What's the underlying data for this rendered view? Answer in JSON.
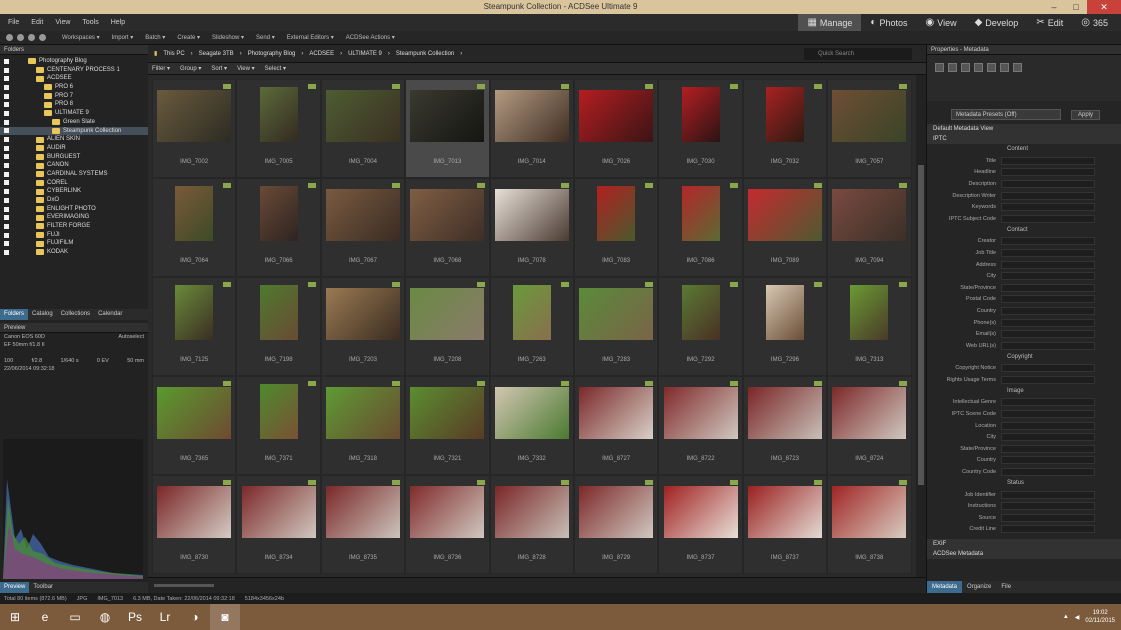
{
  "window": {
    "title": "Steampunk Collection - ACDSee Ultimate 9",
    "min": "–",
    "max": "□",
    "close": "✕"
  },
  "menu": [
    "File",
    "Edit",
    "View",
    "Tools",
    "Help"
  ],
  "modes": [
    {
      "icon": "grid-icon",
      "glyph": "▦",
      "label": "Manage",
      "active": true
    },
    {
      "icon": "photos-icon",
      "glyph": "◐",
      "label": "Photos",
      "active": false
    },
    {
      "icon": "view-icon",
      "glyph": "◉",
      "label": "View",
      "active": false
    },
    {
      "icon": "develop-icon",
      "glyph": "◆",
      "label": "Develop",
      "active": false
    },
    {
      "icon": "edit-icon",
      "glyph": "✂",
      "label": "Edit",
      "active": false
    },
    {
      "icon": "365-icon",
      "glyph": "◎",
      "label": "365",
      "active": false
    }
  ],
  "toolbar": [
    "Workspaces ▾",
    "Import ▾",
    "Batch ▾",
    "Create ▾",
    "Slideshow ▾",
    "Send ▾",
    "External Editors ▾",
    "ACDSee Actions ▾"
  ],
  "folders_panel": {
    "title": "Folders"
  },
  "folders": [
    {
      "name": "Photography Blog",
      "indent": 32,
      "sel": false
    },
    {
      "name": "CENTENARY PROCESS 1",
      "indent": 40,
      "sel": false
    },
    {
      "name": "ACDSEE",
      "indent": 40,
      "sel": false
    },
    {
      "name": "PRO 6",
      "indent": 48,
      "sel": false
    },
    {
      "name": "PRO 7",
      "indent": 48,
      "sel": false
    },
    {
      "name": "PRO 8",
      "indent": 48,
      "sel": false
    },
    {
      "name": "ULTIMATE 9",
      "indent": 48,
      "sel": false
    },
    {
      "name": "Green Slate",
      "indent": 56,
      "sel": false
    },
    {
      "name": "Steampunk Collection",
      "indent": 56,
      "sel": true
    },
    {
      "name": "ALIEN SKIN",
      "indent": 40,
      "sel": false
    },
    {
      "name": "AUDIR",
      "indent": 40,
      "sel": false
    },
    {
      "name": "BURGUEST",
      "indent": 40,
      "sel": false
    },
    {
      "name": "CANON",
      "indent": 40,
      "sel": false
    },
    {
      "name": "CARDINAL SYSTEMS",
      "indent": 40,
      "sel": false
    },
    {
      "name": "COREL",
      "indent": 40,
      "sel": false
    },
    {
      "name": "CYBERLINK",
      "indent": 40,
      "sel": false
    },
    {
      "name": "DxO",
      "indent": 40,
      "sel": false
    },
    {
      "name": "ENLIGHT PHOTO",
      "indent": 40,
      "sel": false
    },
    {
      "name": "EVERIMAGING",
      "indent": 40,
      "sel": false
    },
    {
      "name": "FILTER FORGE",
      "indent": 40,
      "sel": false
    },
    {
      "name": "FUJI",
      "indent": 40,
      "sel": false
    },
    {
      "name": "FUJIFILM",
      "indent": 40,
      "sel": false
    },
    {
      "name": "KODAK",
      "indent": 40,
      "sel": false
    }
  ],
  "lefttabs": [
    "Folders",
    "Catalog",
    "Collections",
    "Calendar"
  ],
  "preview": {
    "title": "Preview",
    "camera": "Canon EOS 60D",
    "lens": "EF 50mm f/1.8 II",
    "mode": "Autoselect",
    "iso": "100",
    "ap": "f/2.8",
    "speed": "1/640 s",
    "ev": "0 EV",
    "focal": "50 mm",
    "date": "22/06/2014 09:32:18"
  },
  "lefttabs2": [
    "Preview",
    "Toolbar"
  ],
  "path": [
    "This PC",
    "Seagate 3TB",
    "Photography Blog",
    "ACDSEE",
    "ULTIMATE 9",
    "Steampunk Collection"
  ],
  "search_placeholder": "Quick Search",
  "filters": [
    "Filter ▾",
    "Group ▾",
    "Sort ▾",
    "View ▾",
    "Select ▾"
  ],
  "thumbs": [
    {
      "name": "IMG_7002",
      "c1": "#6a5a3e",
      "c2": "#2c2c22",
      "p": false
    },
    {
      "name": "IMG_7005",
      "c1": "#5c6a3a",
      "c2": "#332a22",
      "p": true
    },
    {
      "name": "IMG_7004",
      "c1": "#4e5c32",
      "c2": "#3a3022",
      "p": false
    },
    {
      "name": "IMG_7013",
      "c1": "#3a3a30",
      "c2": "#151512",
      "p": false
    },
    {
      "name": "IMG_7014",
      "c1": "#b49a82",
      "c2": "#3e2e22",
      "p": false
    },
    {
      "name": "IMG_7026",
      "c1": "#b41e22",
      "c2": "#3a1414",
      "p": false
    },
    {
      "name": "IMG_7030",
      "c1": "#b41e22",
      "c2": "#2a1414",
      "p": true
    },
    {
      "name": "IMG_7032",
      "c1": "#a82222",
      "c2": "#2e1a12",
      "p": true
    },
    {
      "name": "IMG_7057",
      "c1": "#6e4e34",
      "c2": "#3a4428",
      "p": false
    },
    {
      "name": "IMG_7064",
      "c1": "#7a5a3a",
      "c2": "#3e4a26",
      "p": true
    },
    {
      "name": "IMG_7066",
      "c1": "#6a4a36",
      "c2": "#2e2422",
      "p": true
    },
    {
      "name": "IMG_7067",
      "c1": "#7a5a40",
      "c2": "#3a2c24",
      "p": false
    },
    {
      "name": "IMG_7068",
      "c1": "#805e44",
      "c2": "#3e2e26",
      "p": false
    },
    {
      "name": "IMG_7078",
      "c1": "#e8e0d8",
      "c2": "#4a3a32",
      "p": false
    },
    {
      "name": "IMG_7083",
      "c1": "#b02020",
      "c2": "#4a5a2e",
      "p": true
    },
    {
      "name": "IMG_7086",
      "c1": "#b4262a",
      "c2": "#5a6a34",
      "p": true
    },
    {
      "name": "IMG_7089",
      "c1": "#c42a30",
      "c2": "#4e5a30",
      "p": false
    },
    {
      "name": "IMG_7094",
      "c1": "#7a4a40",
      "c2": "#3a3028",
      "p": false
    },
    {
      "name": "IMG_7125",
      "c1": "#6a8a3a",
      "c2": "#3a2e22",
      "p": true
    },
    {
      "name": "IMG_7198",
      "c1": "#4e7a2e",
      "c2": "#6a4a34",
      "p": true
    },
    {
      "name": "IMG_7203",
      "c1": "#9a7a54",
      "c2": "#3a2c20",
      "p": false
    },
    {
      "name": "IMG_7208",
      "c1": "#6a8a44",
      "c2": "#8a7a6a",
      "p": false
    },
    {
      "name": "IMG_7263",
      "c1": "#6a9a3a",
      "c2": "#8a6e4e",
      "p": true
    },
    {
      "name": "IMG_7283",
      "c1": "#5a8a3a",
      "c2": "#7a6448",
      "p": false
    },
    {
      "name": "IMG_7292",
      "c1": "#5a7a34",
      "c2": "#4a3024",
      "p": true
    },
    {
      "name": "IMG_7296",
      "c1": "#d8c8b4",
      "c2": "#6a4e36",
      "p": true
    },
    {
      "name": "IMG_7313",
      "c1": "#6a9a34",
      "c2": "#4a3a28",
      "p": true
    },
    {
      "name": "IMG_7365",
      "c1": "#5a9a2e",
      "c2": "#6e4a32",
      "p": false
    },
    {
      "name": "IMG_7371",
      "c1": "#4e8a2e",
      "c2": "#7a5034",
      "p": true
    },
    {
      "name": "IMG_7318",
      "c1": "#5e9a34",
      "c2": "#6a4a30",
      "p": false
    },
    {
      "name": "IMG_7321",
      "c1": "#5a8e30",
      "c2": "#5a3a26",
      "p": false
    },
    {
      "name": "IMG_7332",
      "c1": "#d2c6b2",
      "c2": "#4a7a30",
      "p": false
    },
    {
      "name": "IMG_8727",
      "c1": "#7a2828",
      "c2": "#d8d0c8",
      "p": false
    },
    {
      "name": "IMG_8722",
      "c1": "#802a2a",
      "c2": "#d0c8c0",
      "p": false
    },
    {
      "name": "IMG_8723",
      "c1": "#7a2626",
      "c2": "#c8c0b8",
      "p": false
    },
    {
      "name": "IMG_8724",
      "c1": "#7c2828",
      "c2": "#d0c8c0",
      "p": false
    },
    {
      "name": "IMG_8730",
      "c1": "#7a2626",
      "c2": "#d4ccc4",
      "p": false
    },
    {
      "name": "IMG_8734",
      "c1": "#7c2828",
      "c2": "#d0c8c0",
      "p": false
    },
    {
      "name": "IMG_8735",
      "c1": "#7a2828",
      "c2": "#ccc4bc",
      "p": false
    },
    {
      "name": "IMG_8736",
      "c1": "#802a2a",
      "c2": "#d0c8c0",
      "p": false
    },
    {
      "name": "IMG_8728",
      "c1": "#7a2626",
      "c2": "#c8c0b8",
      "p": false
    },
    {
      "name": "IMG_8729",
      "c1": "#7c2828",
      "c2": "#d0c8c0",
      "p": false
    },
    {
      "name": "IMG_8737",
      "c1": "#a02020",
      "c2": "#e8e0d8",
      "p": false
    },
    {
      "name": "IMG_8737",
      "c1": "#9a2020",
      "c2": "#e4dcd4",
      "p": false
    },
    {
      "name": "IMG_8738",
      "c1": "#a02424",
      "c2": "#d8ccc0",
      "p": false
    }
  ],
  "selected_index": 3,
  "statusbar": {
    "total": "Total 80 items (872.6 MB)",
    "type": "JPG",
    "file": "IMG_7013",
    "size": "6.3 MB, Date Taken: 22/06/2014 09:32:18",
    "dims": "5184x3456x24b"
  },
  "properties": {
    "title": "Properties - Metadata",
    "preset": "Metadata Presets (Off)",
    "apply": "Apply",
    "section": "Default Metadata View",
    "iptc": "IPTC",
    "groups": [
      {
        "group": "Content",
        "fields": [
          "Title",
          "Headline",
          "Description",
          "Description Writer",
          "Keywords",
          "IPTC Subject Code"
        ]
      },
      {
        "group": "Contact",
        "fields": [
          "Creator",
          "Job Title",
          "Address",
          "City",
          "State/Province",
          "Postal Code",
          "Country",
          "Phone(s)",
          "Email(s)",
          "Web URL(s)"
        ]
      },
      {
        "group": "Copyright",
        "fields": [
          "Copyright Notice",
          "Rights Usage Terms"
        ]
      },
      {
        "group": "Image",
        "fields": [
          "Intellectual Genre",
          "IPTC Scene Code",
          "Location",
          "City",
          "State/Province",
          "Country",
          "Country Code"
        ]
      },
      {
        "group": "Status",
        "fields": [
          "Job Identifier",
          "Instructions",
          "Source",
          "Credit Line"
        ]
      }
    ],
    "exif": "EXIF",
    "acdsee": "ACDSee Metadata"
  },
  "righttabs": [
    "Metadata",
    "Organize",
    "File"
  ],
  "taskbar": [
    {
      "name": "start-icon",
      "glyph": "⊞"
    },
    {
      "name": "ie-icon",
      "glyph": "e"
    },
    {
      "name": "explorer-icon",
      "glyph": "▭"
    },
    {
      "name": "firefox-icon",
      "glyph": "◍"
    },
    {
      "name": "photoshop-icon",
      "glyph": "Ps"
    },
    {
      "name": "lightroom-icon",
      "glyph": "Lr"
    },
    {
      "name": "app-icon",
      "glyph": "◑"
    },
    {
      "name": "acdsee-icon",
      "glyph": "◙"
    }
  ],
  "clock": {
    "time": "19:02",
    "date": "02/11/2015"
  }
}
